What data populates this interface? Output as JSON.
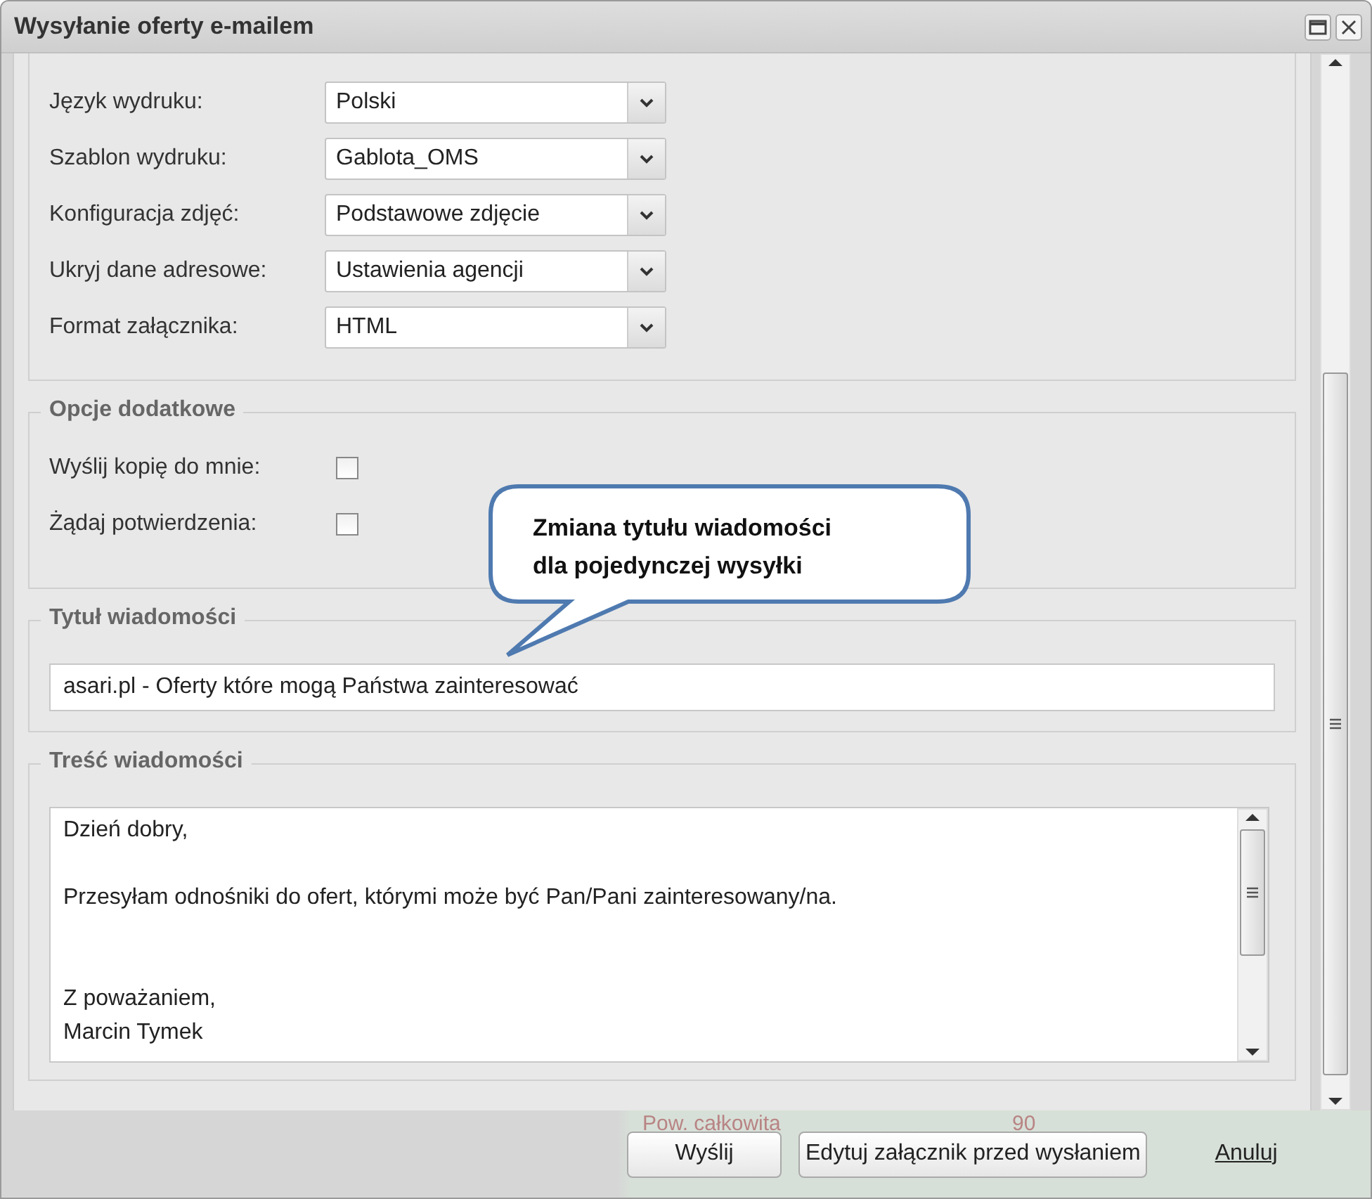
{
  "window": {
    "title": "Wysyłanie oferty e-mailem"
  },
  "print_options": [
    {
      "label": "Język wydruku:",
      "value": "Polski"
    },
    {
      "label": "Szablon wydruku:",
      "value": "Gablota_OMS"
    },
    {
      "label": "Konfiguracja zdjęć:",
      "value": "Podstawowe zdjęcie"
    },
    {
      "label": "Ukryj dane adresowe:",
      "value": "Ustawienia agencji"
    },
    {
      "label": "Format załącznika:",
      "value": "HTML"
    }
  ],
  "extra_options": {
    "legend": "Opcje dodatkowe",
    "items": [
      {
        "label": "Wyślij kopię do mnie:",
        "checked": false
      },
      {
        "label": "Żądaj potwierdzenia:",
        "checked": false
      }
    ]
  },
  "subject": {
    "legend": "Tytuł wiadomości",
    "value": "asari.pl - Oferty które mogą Państwa zainteresować"
  },
  "body": {
    "legend": "Treść wiadomości",
    "value": "Dzień dobry,\n\nPrzesyłam odnośniki do ofert, którymi może być Pan/Pani zainteresowany/na.\n\n\nZ poważaniem,\nMarcin Tymek"
  },
  "callout": {
    "lines": [
      "Zmiana tytułu wiadomości",
      "dla pojedynczej wysyłki"
    ]
  },
  "background_row": {
    "label": "Pow. całkowita",
    "value": "90"
  },
  "buttons": [
    {
      "kind": "button",
      "label": "Wyślij"
    },
    {
      "kind": "button",
      "label": "Edytuj załącznik przed wysłaniem"
    },
    {
      "kind": "link",
      "label": "Anuluj"
    }
  ]
}
